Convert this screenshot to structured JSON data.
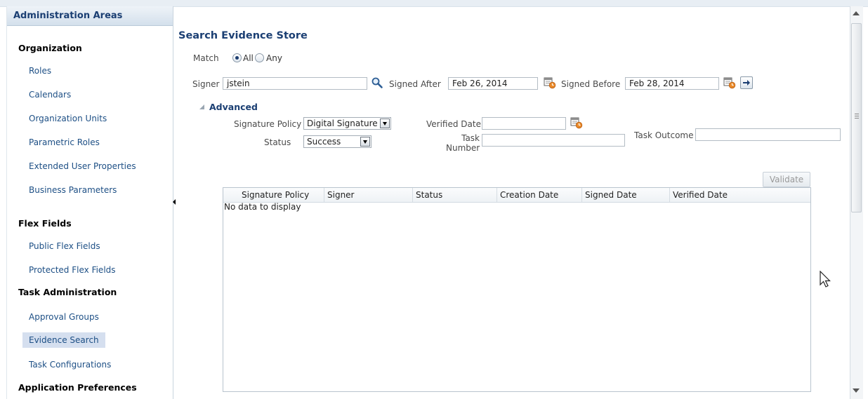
{
  "sidebar": {
    "header": "Administration Areas",
    "sections": {
      "organization": "Organization",
      "flex_fields": "Flex Fields",
      "task_admin": "Task Administration",
      "app_prefs": "Application Preferences"
    },
    "items": {
      "roles": "Roles",
      "calendars": "Calendars",
      "org_units": "Organization Units",
      "parametric_roles": "Parametric Roles",
      "extended_user_props": "Extended User Properties",
      "business_params": "Business Parameters",
      "public_flex": "Public Flex Fields",
      "protected_flex": "Protected Flex Fields",
      "approval_groups": "Approval Groups",
      "evidence_search": "Evidence Search",
      "task_configs": "Task Configurations"
    },
    "active_item": "Evidence Search"
  },
  "search": {
    "title": "Search Evidence Store",
    "match_label": "Match",
    "match_all": "All",
    "match_any": "Any",
    "signer_label": "Signer",
    "signer_value": "jstein",
    "signed_after_label": "Signed After",
    "signed_after_value": "Feb 26, 2014",
    "signed_before_label": "Signed Before",
    "signed_before_value": "Feb 28, 2014",
    "advanced_label": "Advanced",
    "sig_policy_label": "Signature Policy",
    "sig_policy_value": "Digital Signature",
    "status_label": "Status",
    "status_value": "Success",
    "verified_date_label": "Verified Date",
    "verified_date_value": "",
    "task_number_label_1": "Task",
    "task_number_label_2": "Number",
    "task_number_value": "",
    "task_outcome_label": "Task Outcome",
    "task_outcome_value": ""
  },
  "results": {
    "validate_label": "Validate",
    "columns": [
      "Signature Policy",
      "Signer",
      "Status",
      "Creation Date",
      "Signed Date",
      "Verified Date"
    ],
    "empty_message": "No data to display"
  },
  "icons": {
    "search": "magnifier-icon",
    "calendar": "calendar-icon",
    "go": "arrow-right-icon",
    "collapse": "collapse-left-icon"
  },
  "colors": {
    "heading": "#1b3f73",
    "link": "#1d4f85",
    "selected_bg": "#d5dfef"
  }
}
